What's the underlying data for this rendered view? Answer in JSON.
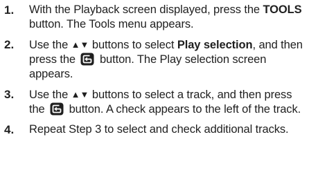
{
  "steps": [
    {
      "number": "1.",
      "parts": {
        "a": "With the Playback screen displayed, press the ",
        "b": "TOOLS",
        "c": " button. The Tools menu appears."
      }
    },
    {
      "number": "2.",
      "parts": {
        "a": "Use the ",
        "arrows": "▲▼",
        "b": " buttons to select ",
        "c": "Play selection",
        "d": ", and then press the ",
        "e": " button. The Play selection screen appears."
      }
    },
    {
      "number": "3.",
      "parts": {
        "a": "Use the ",
        "arrows": "▲▼",
        "b": " buttons to select a track, and then press the ",
        "c": " button. A check appears to the left of the track."
      }
    },
    {
      "number": "4.",
      "parts": {
        "a": "Repeat Step 3 to select and check additional tracks."
      }
    }
  ],
  "icons": {
    "enter_button": "enter-button-icon"
  },
  "colors": {
    "text": "#1f1f1f",
    "icon_fill": "#1f1f1f",
    "icon_symbol": "#ffffff"
  }
}
